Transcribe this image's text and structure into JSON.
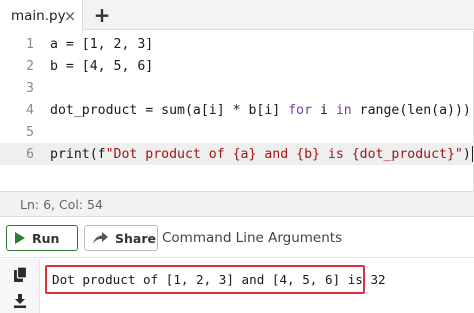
{
  "tabs": {
    "active_tab": {
      "label": "main.py",
      "close_glyph": "×"
    },
    "add_glyph": "+"
  },
  "editor": {
    "lines": [
      {
        "number": "1",
        "parts": [
          {
            "t": "a = [1, 2, 3]"
          }
        ]
      },
      {
        "number": "2",
        "parts": [
          {
            "t": "b = [4, 5, 6]"
          }
        ]
      },
      {
        "number": "3",
        "parts": []
      },
      {
        "number": "4",
        "parts": [
          {
            "t": "dot_product = sum(a[i] * b[i] "
          },
          {
            "t": "for",
            "c": "kw"
          },
          {
            "t": " i "
          },
          {
            "t": "in",
            "c": "kw"
          },
          {
            "t": " range(len(a)))"
          }
        ]
      },
      {
        "number": "5",
        "parts": []
      },
      {
        "number": "6",
        "parts": [
          {
            "t": "print(f"
          },
          {
            "t": "\"Dot product of {a} and {b} is {dot_product}\"",
            "c": "str"
          },
          {
            "t": ")"
          }
        ],
        "active": true
      }
    ]
  },
  "status": {
    "position_text": "Ln: 6,  Col: 54"
  },
  "toolbar": {
    "run_label": "Run",
    "share_label": "Share",
    "args_placeholder": "Command Line Arguments"
  },
  "output": {
    "text": "Dot product of [1, 2, 3] and [4, 5, 6] is 32",
    "highlight_color": "#d9343a"
  },
  "icons": {
    "run": "play-icon",
    "share": "share-icon",
    "copy": "copy-icon",
    "download": "download-icon"
  }
}
